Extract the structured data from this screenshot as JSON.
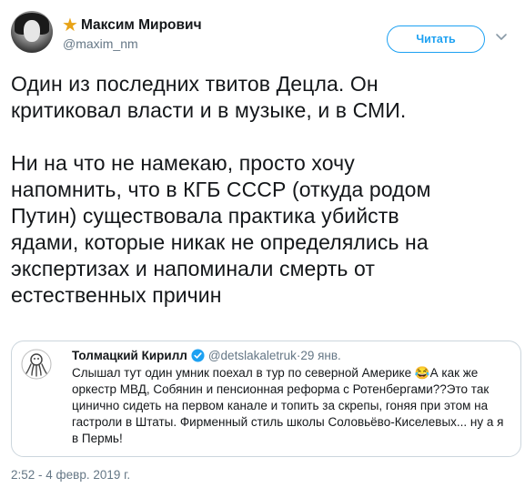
{
  "header": {
    "display_name": "Максим Мирович",
    "handle": "@maxim_nm",
    "follow_label": "Читать"
  },
  "tweet": {
    "paragraph_1": "Один из последних твитов Децла. Он\nкритиковал власти и в музыке, и в СМИ.",
    "paragraph_2": "Ни на что не намекаю, просто хочу\nнапомнить, что в КГБ СССР (откуда родом\nПутин) существовала практика убийств\nядами, которые никак не определялись на\nэкспертизах и напоминали смерть от\nестественных причин"
  },
  "quote": {
    "name": "Толмацкий Кирилл",
    "handle": "@detslakaletruk",
    "separator": " · ",
    "date": "29 янв.",
    "text": "Слышал тут один умник поехал в тур по северной Америке 😂А как же оркестр МВД, Собянин и пенсионная реформа с Ротенбергами??Это так цинично сидеть на первом канале и топить за скрепы, гоняя при этом на гастроли в Штаты. Фирменный стиль школы Соловьёво-Киселевых... ну а я в Пермь!"
  },
  "timestamp": "2:52 - 4 февр. 2019 г.",
  "colors": {
    "accent": "#1da1f2",
    "secondary_text": "#657786",
    "star": "#e8a317"
  }
}
